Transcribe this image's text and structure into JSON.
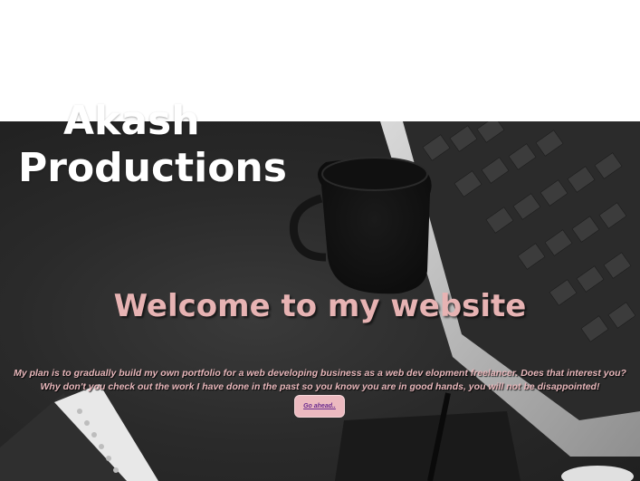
{
  "brand": {
    "line1": "Akash",
    "line2": "Productions"
  },
  "hero": {
    "heading": "Welcome to my website",
    "intro": "My plan is to gradually build my own portfolio for a web developing business as a web dev elopment freelancer. Does that interest you? Why don't you check out the work I have done in the past so you know you are in good hands, you will not be disappointed!",
    "cta_label": "Go ahead..",
    "background_image": "desk-with-laptop-coffee-mug-notebooks"
  },
  "colors": {
    "heading": "#e7b3b3",
    "intro_text": "#e8b7bb",
    "button_bg": "#ecbac0",
    "button_text": "#6a2a8e",
    "hero_dark": "#2a2a2a"
  }
}
